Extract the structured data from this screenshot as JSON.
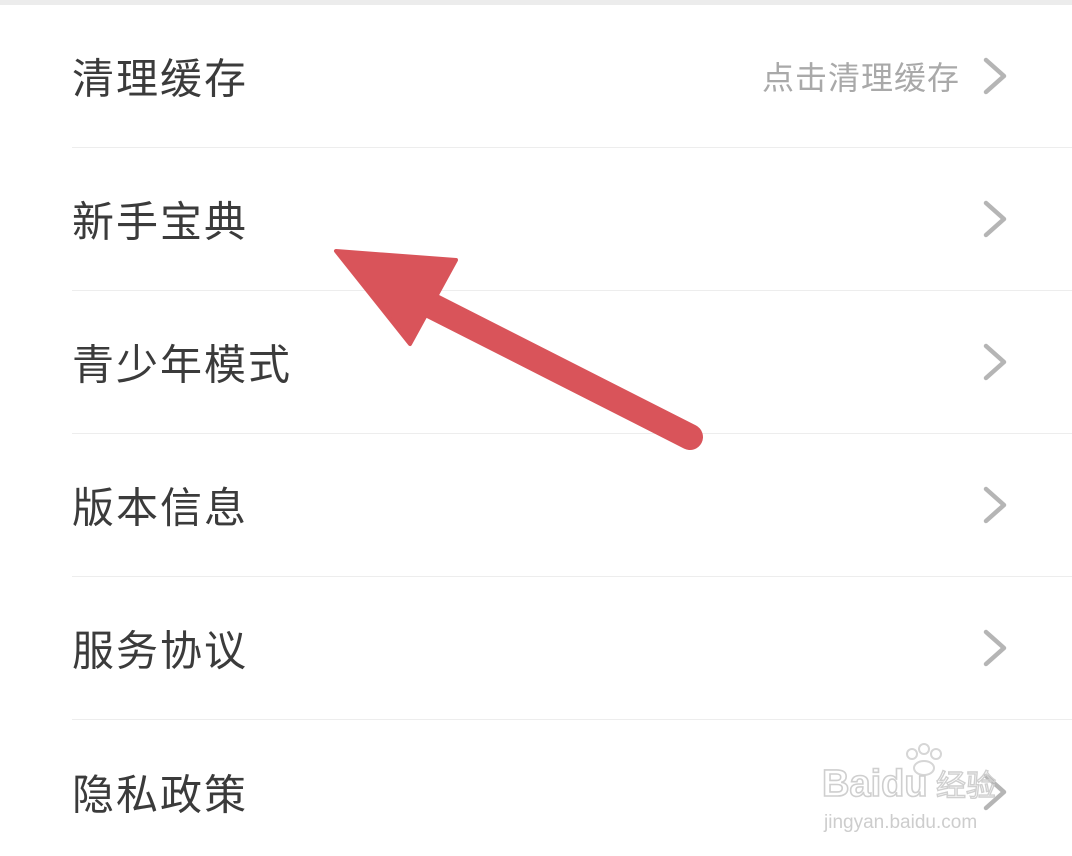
{
  "settings": {
    "items": [
      {
        "label": "清理缓存",
        "value": "点击清理缓存"
      },
      {
        "label": "新手宝典",
        "value": ""
      },
      {
        "label": "青少年模式",
        "value": ""
      },
      {
        "label": "版本信息",
        "value": ""
      },
      {
        "label": "服务协议",
        "value": ""
      },
      {
        "label": "隐私政策",
        "value": ""
      }
    ]
  },
  "annotation": {
    "arrow_color": "#d9545a",
    "points_to": "新手宝典"
  },
  "watermark": {
    "brand": "Baidu",
    "brand_cn": "经验",
    "url": "jingyan.baidu.com"
  },
  "colors": {
    "label": "#3b3b3b",
    "value": "#a9a9a9",
    "chevron": "#b5b5b5",
    "divider": "#ededed"
  }
}
